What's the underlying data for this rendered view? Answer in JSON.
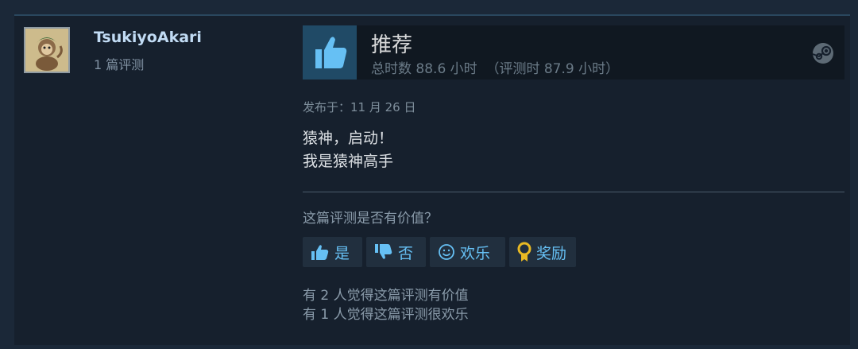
{
  "author": {
    "persona_name": "TsukiyoAkari",
    "review_count": "1 篇评测"
  },
  "review": {
    "recommendation": "推荐",
    "hours": "总时数 88.6 小时  （评测时 87.9 小时）",
    "posted": "发布于：11 月 26 日",
    "content_lines": [
      "猿神，启动！",
      "我是猿神高手"
    ]
  },
  "feedback": {
    "question": "这篇评测是否有价值？",
    "yes_label": "是",
    "no_label": "否",
    "funny_label": "欢乐",
    "award_label": "奖励",
    "helpful_text": "有 2 人觉得这篇评测有价值",
    "funny_text": "有 1 人觉得这篇评测很欢乐"
  },
  "colors": {
    "background": "#1b2838",
    "card": "#16202d",
    "accent": "#66c0f4",
    "award_gold": "#e8b923"
  },
  "icons": {
    "recommend": "thumbs-up-icon",
    "platform": "steam-icon",
    "yes": "thumbs-up-icon",
    "no": "thumbs-down-icon",
    "funny": "smiley-icon",
    "award": "award-medal-icon"
  }
}
